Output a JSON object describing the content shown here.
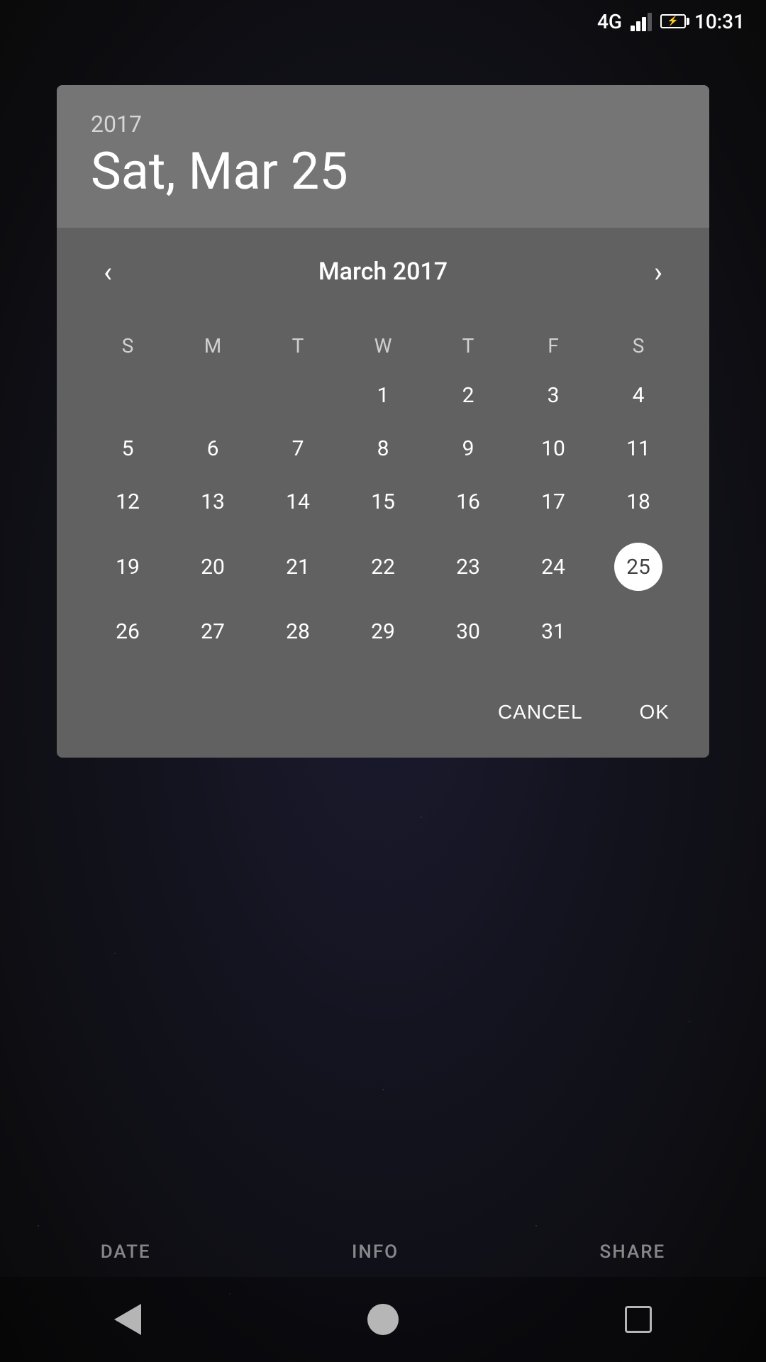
{
  "statusBar": {
    "time": "10:31",
    "network": "4G"
  },
  "dialog": {
    "year": "2017",
    "selectedDate": "Sat, Mar 25",
    "monthYear": "March 2017",
    "selectedDay": 25,
    "dayHeaders": [
      "S",
      "M",
      "T",
      "W",
      "T",
      "F",
      "S"
    ],
    "weeks": [
      [
        null,
        null,
        null,
        1,
        2,
        3,
        4
      ],
      [
        5,
        6,
        7,
        8,
        9,
        10,
        11
      ],
      [
        12,
        13,
        14,
        15,
        16,
        17,
        18
      ],
      [
        19,
        20,
        21,
        22,
        23,
        24,
        25
      ],
      [
        26,
        27,
        28,
        29,
        30,
        31,
        null
      ]
    ],
    "cancelLabel": "CANCEL",
    "okLabel": "OK"
  },
  "bottomNav": {
    "items": [
      {
        "label": "DATE"
      },
      {
        "label": "INFO"
      },
      {
        "label": "SHARE"
      }
    ]
  }
}
